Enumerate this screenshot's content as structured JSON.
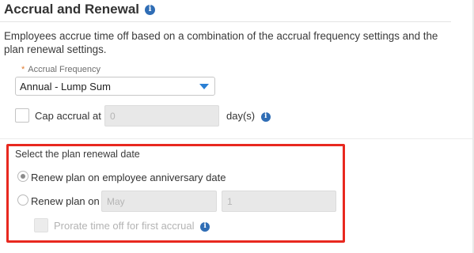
{
  "section": {
    "title": "Accrual and Renewal",
    "description": "Employees accrue time off based on a combination of the accrual frequency settings and the plan renewal settings."
  },
  "accrual_frequency": {
    "required_marker": "*",
    "label": "Accrual Frequency",
    "selected": "Annual - Lump Sum"
  },
  "cap_accrual": {
    "label": "Cap accrual at",
    "value": "0",
    "unit": "day(s)"
  },
  "renewal": {
    "heading": "Select the plan renewal date",
    "option_anniversary": "Renew plan on employee anniversary date",
    "option_on": "Renew plan on",
    "month_value": "May",
    "day_value": "1",
    "prorate_label": "Prorate time off for first accrual"
  },
  "colors": {
    "accent": "#2a7fd4",
    "info_icon": "#2f6db5",
    "highlight": "#e8281f"
  }
}
